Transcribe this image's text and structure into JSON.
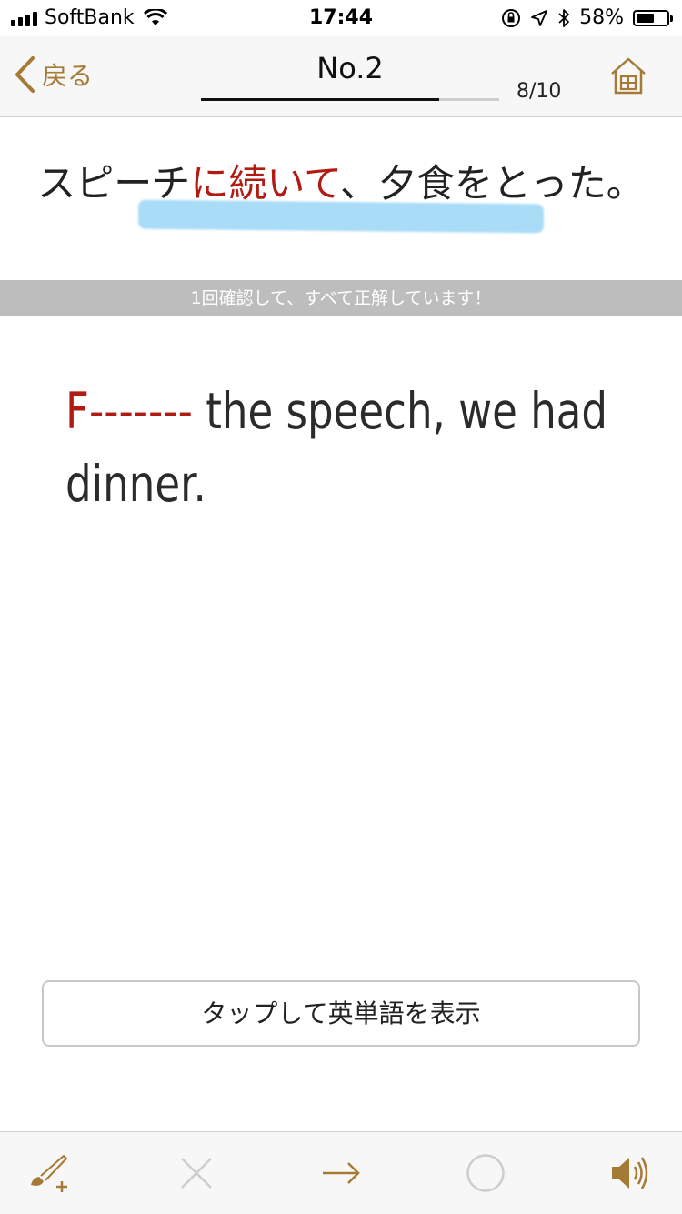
{
  "status_bar": {
    "carrier": "SoftBank",
    "time": "17:44",
    "battery_percent": "58%",
    "battery_level": 0.58
  },
  "nav": {
    "back_label": "戻る",
    "title": "No.2",
    "counter": "8/10",
    "progress": 0.8
  },
  "question": {
    "pre": "スピーチ",
    "highlight": "に続いて",
    "post": "、夕食をとった。"
  },
  "info_bar": {
    "text": "1回確認して、すべて正解しています！"
  },
  "answer": {
    "blank": "F-------",
    "rest": " the speech, we had dinner."
  },
  "reveal_button": {
    "label": "タップして英単語を表示"
  },
  "colors": {
    "accent": "#a57a35",
    "highlight_red": "#b01b13",
    "blur_blue": "#a9dcf7",
    "info_gray": "#bdbdbd"
  },
  "toolbar": {
    "icons": [
      "brush-add-icon",
      "close-icon",
      "arrow-right-icon",
      "circle-icon",
      "speaker-icon"
    ]
  }
}
